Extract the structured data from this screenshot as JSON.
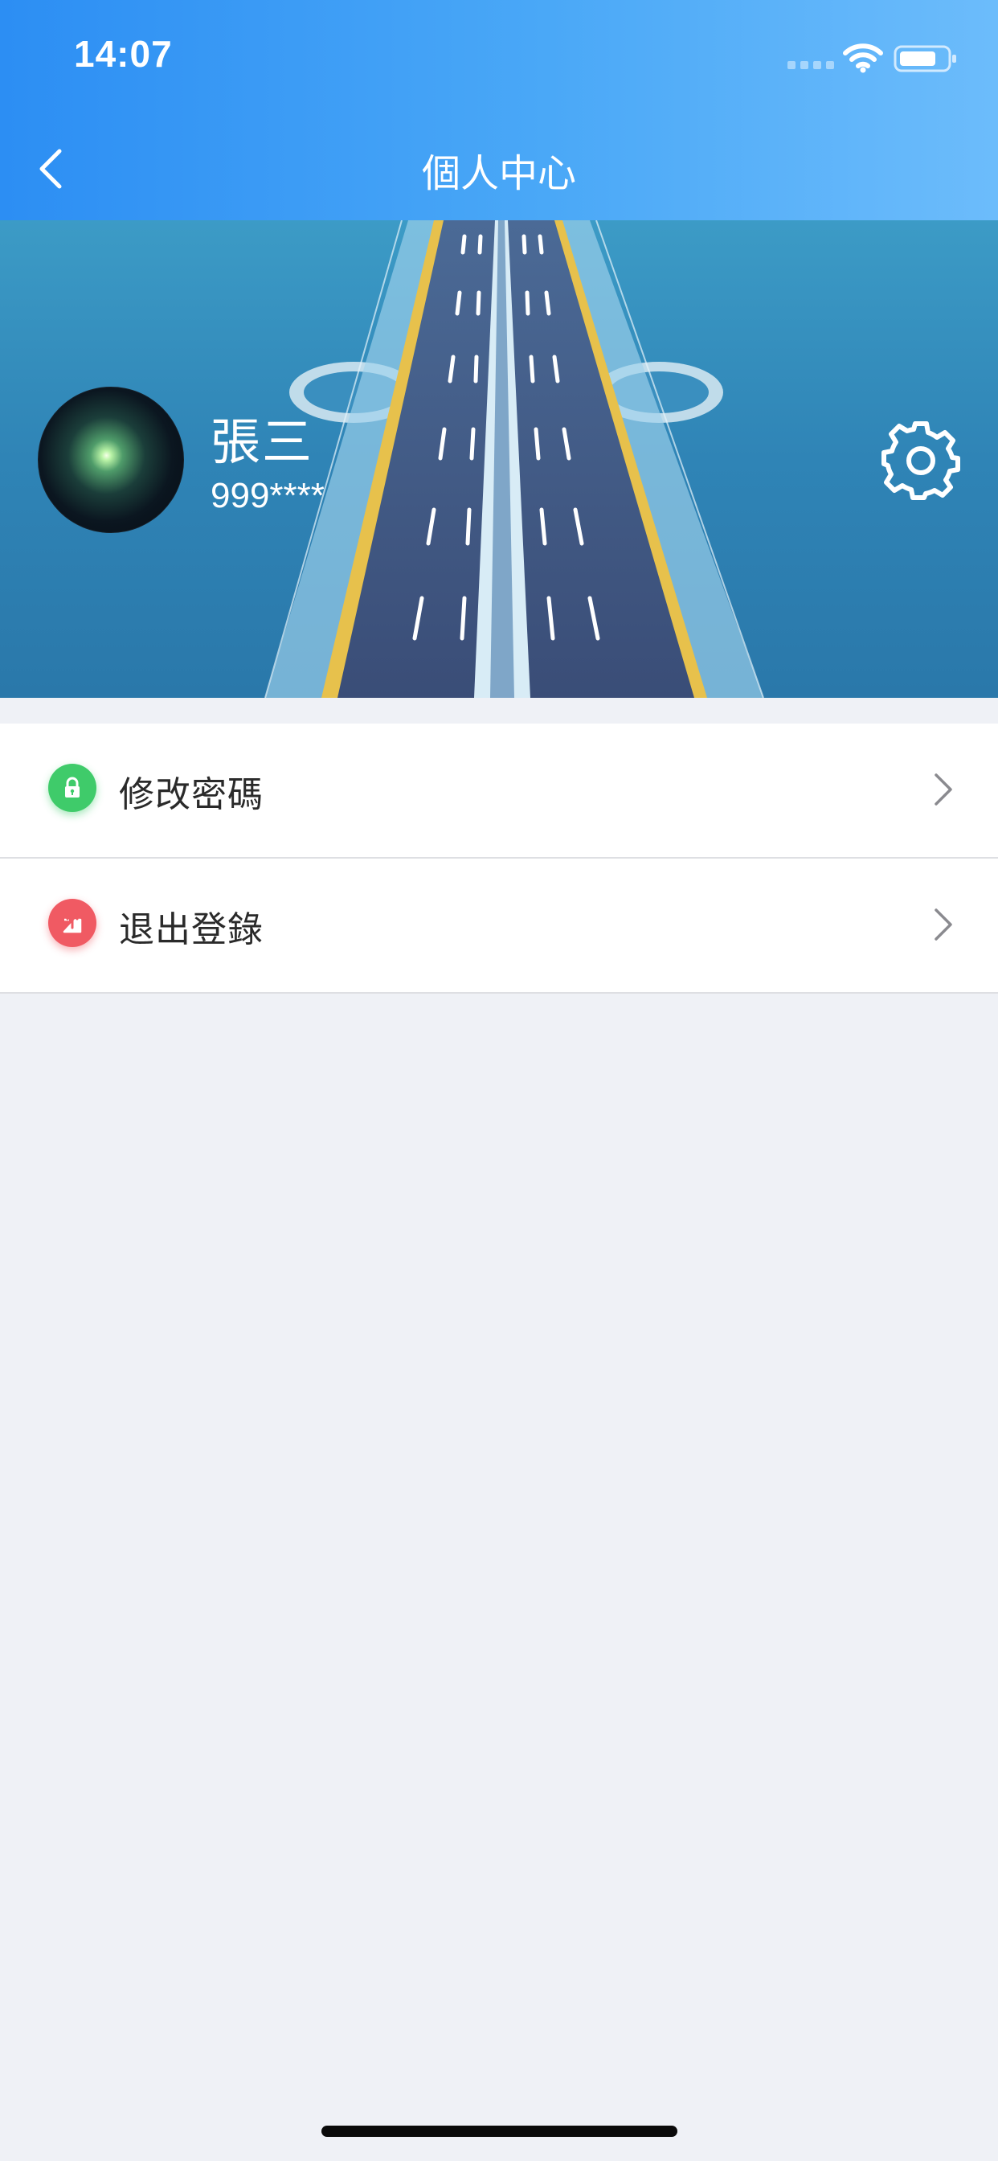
{
  "status_bar": {
    "time": "14:07"
  },
  "nav": {
    "title": "個人中心",
    "back_icon": "chevron-left-icon"
  },
  "profile": {
    "name": "張三",
    "account": "999****",
    "settings_icon": "gear-icon"
  },
  "menu": {
    "items": [
      {
        "label": "修改密碼",
        "icon": "lock-icon",
        "icon_color": "#3fcb6a"
      },
      {
        "label": "退出登錄",
        "icon": "logout-icon",
        "icon_color": "#f05a63"
      }
    ]
  },
  "colors": {
    "header_start": "#2c8ef3",
    "header_end": "#6cbcfb",
    "page_bg": "#eff1f6"
  }
}
